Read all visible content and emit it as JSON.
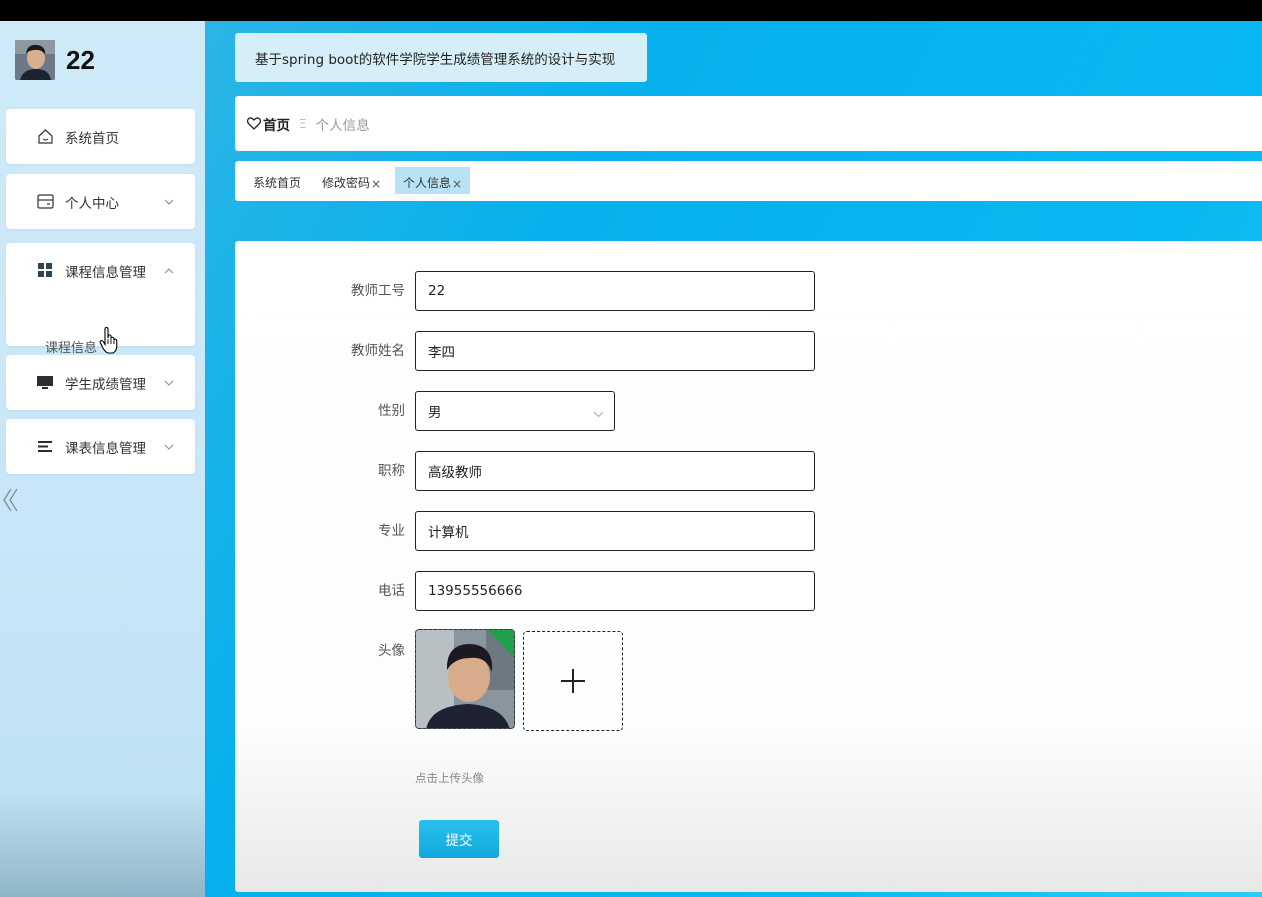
{
  "user": {
    "name": "22"
  },
  "app": {
    "title": "基于spring boot的软件学院学生成绩管理系统的设计与实现"
  },
  "sidebar": {
    "items": [
      {
        "label": "系统首页",
        "icon": "home-icon"
      },
      {
        "label": "个人中心",
        "icon": "wallet-icon",
        "expanded": false
      },
      {
        "label": "课程信息管理",
        "icon": "grid-icon",
        "expanded": true,
        "children": [
          {
            "label": "课程信息"
          }
        ]
      },
      {
        "label": "学生成绩管理",
        "icon": "monitor-icon",
        "expanded": false
      },
      {
        "label": "课表信息管理",
        "icon": "list-icon",
        "expanded": false
      }
    ]
  },
  "breadcrumb": {
    "home": "首页",
    "separator": "Ξ",
    "current": "个人信息"
  },
  "tabs": [
    {
      "label": "系统首页",
      "closable": false,
      "active": false
    },
    {
      "label": "修改密码",
      "closable": true,
      "active": false
    },
    {
      "label": "个人信息",
      "closable": true,
      "active": true
    }
  ],
  "form": {
    "fields": [
      {
        "label": "教师工号",
        "value": "22"
      },
      {
        "label": "教师姓名",
        "value": "李四"
      },
      {
        "label": "性别",
        "value": "男"
      },
      {
        "label": "职称",
        "value": "高级教师"
      },
      {
        "label": "专业",
        "value": "计算机"
      },
      {
        "label": "电话",
        "value": "13955556666"
      }
    ],
    "avatar_label": "头像",
    "upload_hint": "点击上传头像",
    "submit_label": "提交"
  },
  "colors": {
    "accent": "#08b8f2",
    "sidebar_bg": "#c7e6f7",
    "active_tab": "#b8e3f5"
  }
}
